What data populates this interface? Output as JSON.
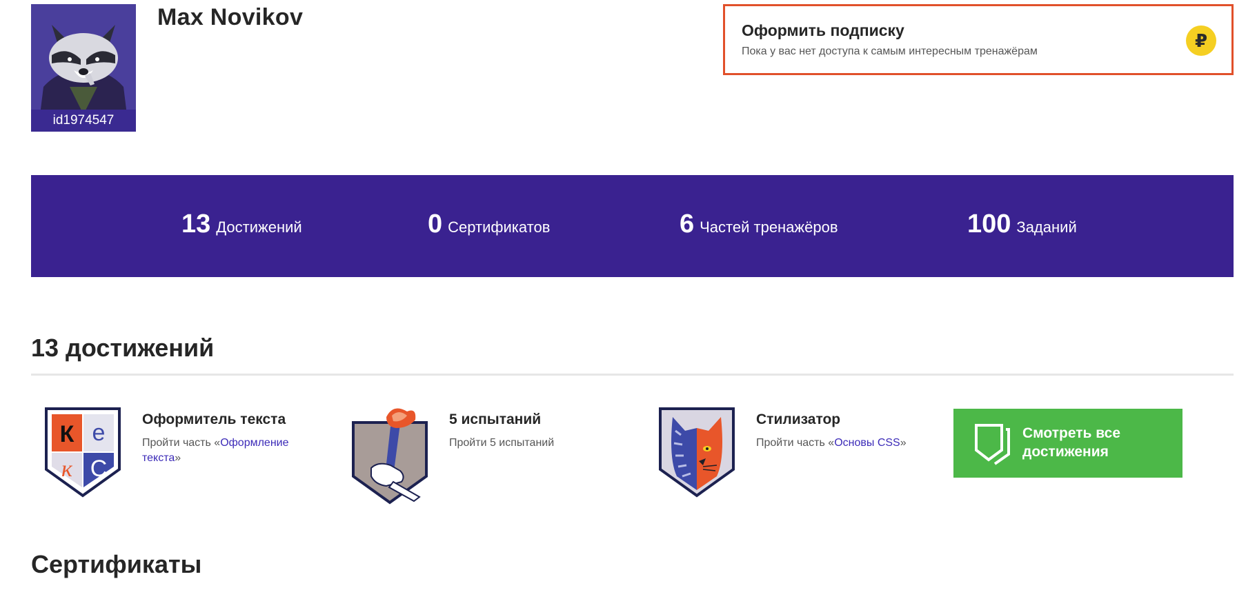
{
  "profile": {
    "name": "Max Novikov",
    "user_id": "id1974547"
  },
  "subscription": {
    "title": "Оформить подписку",
    "text": "Пока у вас нет доступа к самым интересным тренажёрам",
    "coin_symbol": "₽",
    "border_color": "#e1502a",
    "coin_color": "#f5cf22"
  },
  "stats": [
    {
      "value": "13",
      "label": "Достижений"
    },
    {
      "value": "0",
      "label": "Сертификатов"
    },
    {
      "value": "6",
      "label": "Частей тренажёров"
    },
    {
      "value": "100",
      "label": "Заданий"
    }
  ],
  "stats_bar_color": "#3a2290",
  "achievements_section": {
    "title": "13 достижений"
  },
  "achievements": [
    {
      "title": "Оформитель текста",
      "desc_prefix": "Пройти часть «",
      "desc_link": "Оформление текста",
      "desc_suffix": "»",
      "badge_letters": [
        "К",
        "е",
        "к",
        "С"
      ],
      "icon": "keks-letters-badge-icon"
    },
    {
      "title": "5 испытаний",
      "desc_prefix": "Пройти 5 испытаний",
      "desc_link": "",
      "desc_suffix": "",
      "icon": "torch-hand-badge-icon"
    },
    {
      "title": "Стилизатор",
      "desc_prefix": "Пройти часть «",
      "desc_link": "Основы CSS",
      "desc_suffix": "»",
      "icon": "cat-badge-icon"
    }
  ],
  "view_all_button": {
    "label": "Смотреть все достижения",
    "color": "#4cb848"
  },
  "certificates_section": {
    "title": "Сертификаты"
  }
}
